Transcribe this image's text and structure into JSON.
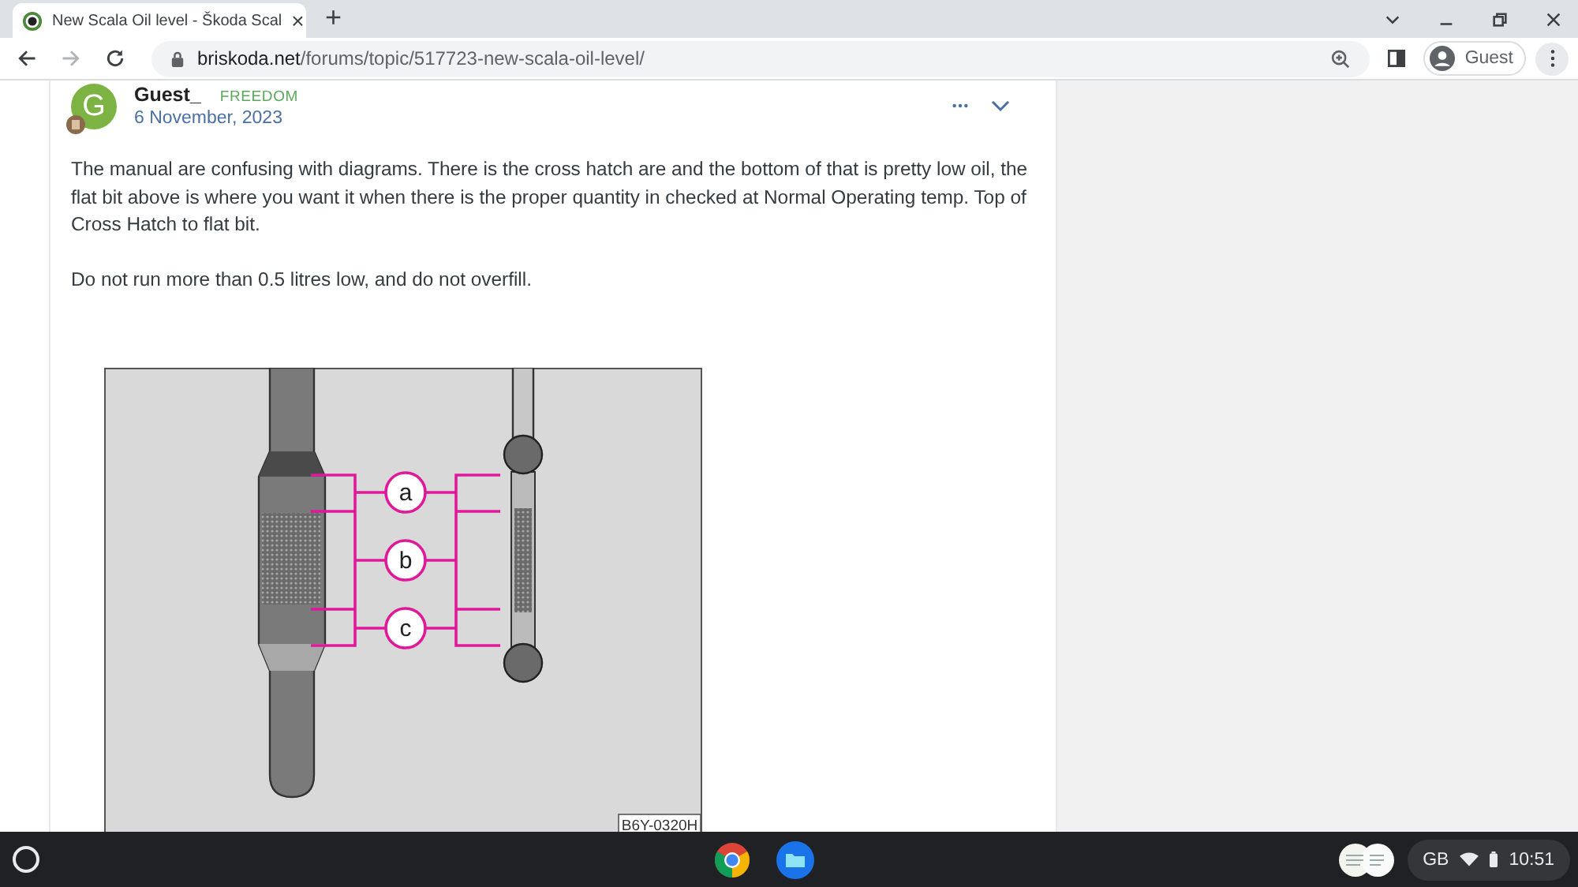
{
  "tab": {
    "title": "New Scala Oil level - Škoda Scal",
    "close": "×"
  },
  "new_tab": "+",
  "address_bar": {
    "host": "briskoda.net",
    "path": "/forums/topic/517723-new-scala-oil-level/"
  },
  "profile": {
    "label": "Guest"
  },
  "post": {
    "avatar_letter": "G",
    "author": "Guest_",
    "group": "FREEDOM",
    "date": "6 November, 2023",
    "paragraphs": [
      "The manual are confusing with diagrams.  There is the cross hatch are and the bottom of that is pretty low oil,  the flat bit above is where you want it when there is the proper quantity in checked at Normal Operating temp. Top of Cross Hatch to flat bit.",
      "Do not run more than 0.5 litres low, and do not overfill."
    ],
    "figure": {
      "markers": [
        "a",
        "b",
        "c"
      ],
      "code": "B6Y-0320H"
    }
  },
  "shelf": {
    "ime": "GB",
    "time": "10:51"
  }
}
